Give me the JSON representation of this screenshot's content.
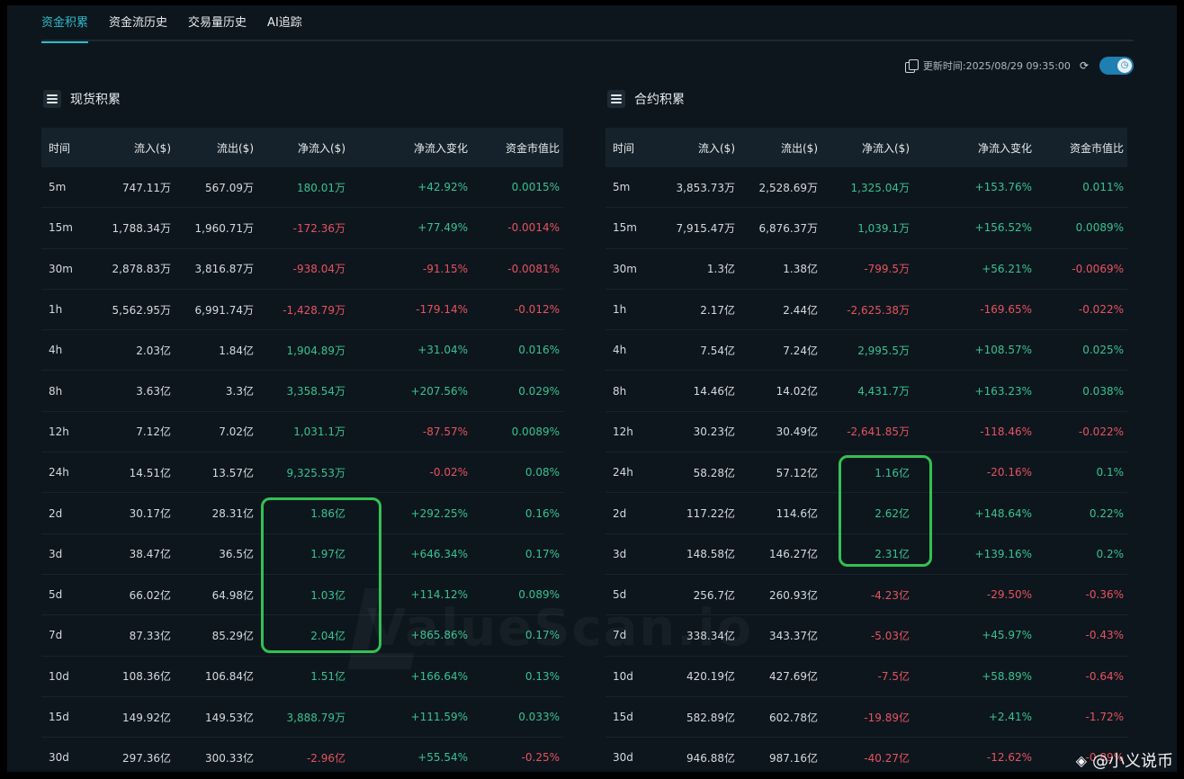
{
  "tabs": [
    "资金积累",
    "资金流历史",
    "交易量历史",
    "AI追踪"
  ],
  "active_tab": 0,
  "update_time": "更新时间:2025/08/29 09:35:00",
  "spot": {
    "title": "现货积累",
    "headers": [
      "时间",
      "流入($)",
      "流出($)",
      "净流入($)",
      "净流入变化",
      "资金市值比"
    ],
    "rows": [
      [
        "5m",
        "747.11万",
        "567.09万",
        "180.01万",
        "+42.92%",
        "0.0015%"
      ],
      [
        "15m",
        "1,788.34万",
        "1,960.71万",
        "-172.36万",
        "+77.49%",
        "-0.0014%"
      ],
      [
        "30m",
        "2,878.83万",
        "3,816.87万",
        "-938.04万",
        "-91.15%",
        "-0.0081%"
      ],
      [
        "1h",
        "5,562.95万",
        "6,991.74万",
        "-1,428.79万",
        "-179.14%",
        "-0.012%"
      ],
      [
        "4h",
        "2.03亿",
        "1.84亿",
        "1,904.89万",
        "+31.04%",
        "0.016%"
      ],
      [
        "8h",
        "3.63亿",
        "3.3亿",
        "3,358.54万",
        "+207.56%",
        "0.029%"
      ],
      [
        "12h",
        "7.12亿",
        "7.02亿",
        "1,031.1万",
        "-87.57%",
        "0.0089%"
      ],
      [
        "24h",
        "14.51亿",
        "13.57亿",
        "9,325.53万",
        "-0.02%",
        "0.08%"
      ],
      [
        "2d",
        "30.17亿",
        "28.31亿",
        "1.86亿",
        "+292.25%",
        "0.16%"
      ],
      [
        "3d",
        "38.47亿",
        "36.5亿",
        "1.97亿",
        "+646.34%",
        "0.17%"
      ],
      [
        "5d",
        "66.02亿",
        "64.98亿",
        "1.03亿",
        "+114.12%",
        "0.089%"
      ],
      [
        "7d",
        "87.33亿",
        "85.29亿",
        "2.04亿",
        "+865.86%",
        "0.17%"
      ],
      [
        "10d",
        "108.36亿",
        "106.84亿",
        "1.51亿",
        "+166.64%",
        "0.13%"
      ],
      [
        "15d",
        "149.92亿",
        "149.53亿",
        "3,888.79万",
        "+111.59%",
        "0.033%"
      ],
      [
        "30d",
        "297.36亿",
        "300.33亿",
        "-2.96亿",
        "+55.54%",
        "-0.25%"
      ]
    ]
  },
  "futures": {
    "title": "合约积累",
    "headers": [
      "时间",
      "流入($)",
      "流出($)",
      "净流入($)",
      "净流入变化",
      "资金市值比"
    ],
    "rows": [
      [
        "5m",
        "3,853.73万",
        "2,528.69万",
        "1,325.04万",
        "+153.76%",
        "0.011%"
      ],
      [
        "15m",
        "7,915.47万",
        "6,876.37万",
        "1,039.1万",
        "+156.52%",
        "0.0089%"
      ],
      [
        "30m",
        "1.3亿",
        "1.38亿",
        "-799.5万",
        "+56.21%",
        "-0.0069%"
      ],
      [
        "1h",
        "2.17亿",
        "2.44亿",
        "-2,625.38万",
        "-169.65%",
        "-0.022%"
      ],
      [
        "4h",
        "7.54亿",
        "7.24亿",
        "2,995.5万",
        "+108.57%",
        "0.025%"
      ],
      [
        "8h",
        "14.46亿",
        "14.02亿",
        "4,431.7万",
        "+163.23%",
        "0.038%"
      ],
      [
        "12h",
        "30.23亿",
        "30.49亿",
        "-2,641.85万",
        "-118.46%",
        "-0.022%"
      ],
      [
        "24h",
        "58.28亿",
        "57.12亿",
        "1.16亿",
        "-20.16%",
        "0.1%"
      ],
      [
        "2d",
        "117.22亿",
        "114.6亿",
        "2.62亿",
        "+148.64%",
        "0.22%"
      ],
      [
        "3d",
        "148.58亿",
        "146.27亿",
        "2.31亿",
        "+139.16%",
        "0.2%"
      ],
      [
        "5d",
        "256.7亿",
        "260.93亿",
        "-4.23亿",
        "-29.50%",
        "-0.36%"
      ],
      [
        "7d",
        "338.34亿",
        "343.37亿",
        "-5.03亿",
        "+45.97%",
        "-0.43%"
      ],
      [
        "10d",
        "420.19亿",
        "427.69亿",
        "-7.5亿",
        "+58.89%",
        "-0.64%"
      ],
      [
        "15d",
        "582.89亿",
        "602.78亿",
        "-19.89亿",
        "+2.41%",
        "-1.72%"
      ],
      [
        "30d",
        "946.88亿",
        "987.16亿",
        "-40.27亿",
        "-12.62%",
        "-0.89%"
      ]
    ]
  },
  "watermark": "ValueScan.io",
  "footer_mark": "@小义说币",
  "colors": {
    "accent": "#2fb9c9",
    "positive": "#37c28f",
    "negative": "#e8525f",
    "highlight": "#33c153"
  }
}
